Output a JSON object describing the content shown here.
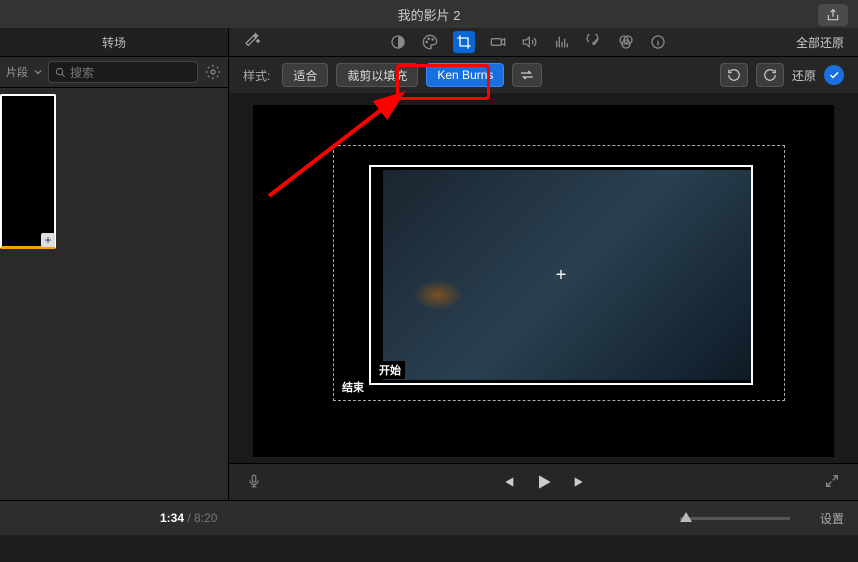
{
  "titlebar": {
    "title": "我的影片 2"
  },
  "left": {
    "tab": "转场",
    "segment_label": "片段",
    "search_placeholder": "搜索"
  },
  "toolbar": {
    "revert_all": "全部还原"
  },
  "style": {
    "label": "样式:",
    "fit": "适合",
    "crop_fill": "裁剪以填充",
    "ken_burns": "Ken Burns",
    "revert": "还原"
  },
  "preview": {
    "start_label": "开始",
    "end_label": "结束"
  },
  "time": {
    "current": "1:34",
    "duration": "8:20"
  },
  "bottom": {
    "settings": "设置"
  },
  "icons": {
    "share": "share-icon",
    "wand": "wand-icon",
    "search": "search-icon",
    "gear": "gear-icon",
    "dropdown": "chevron-down-icon",
    "plus": "plus-icon",
    "contrast": "contrast-icon",
    "palette": "palette-icon",
    "crop": "crop-icon",
    "camera": "camera-icon",
    "audio": "audio-icon",
    "eq": "eq-icon",
    "speed": "speed-icon",
    "filter": "filter-icon",
    "info": "info-icon",
    "swap": "swap-icon",
    "rot_ccw": "rotate-ccw-icon",
    "rot_cw": "rotate-cw-icon",
    "check": "check-icon",
    "mic": "mic-icon",
    "prev": "prev-icon",
    "play": "play-icon",
    "next": "next-icon",
    "expand": "expand-icon"
  }
}
